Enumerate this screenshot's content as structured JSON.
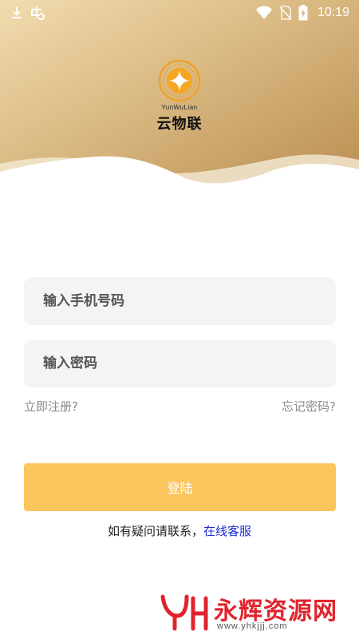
{
  "status_bar": {
    "time": "10:19",
    "left_icons": [
      "download-icon",
      "bug-icon"
    ],
    "right_icons": [
      "wifi-icon",
      "no-sim-icon",
      "battery-charging-icon"
    ]
  },
  "brand": {
    "latin": "YunWuLian",
    "name": "云物联",
    "colors": {
      "header_gold": "#c9a468",
      "header_light": "#e8d2a6"
    }
  },
  "login_form": {
    "phone_placeholder": "输入手机号码",
    "phone_value": "",
    "password_placeholder": "输入密码",
    "password_value": "",
    "register_link": "立即注册?",
    "forgot_link": "忘记密码?",
    "login_button": "登陆",
    "login_button_color": "#fbc65e"
  },
  "contact": {
    "prefix": "如有疑问请联系，",
    "link": "在线客服",
    "link_color": "#1a2bd6"
  },
  "watermark": {
    "text": "永辉资源网",
    "url": "www.yhkjjj.com",
    "color": "#e0242e"
  }
}
